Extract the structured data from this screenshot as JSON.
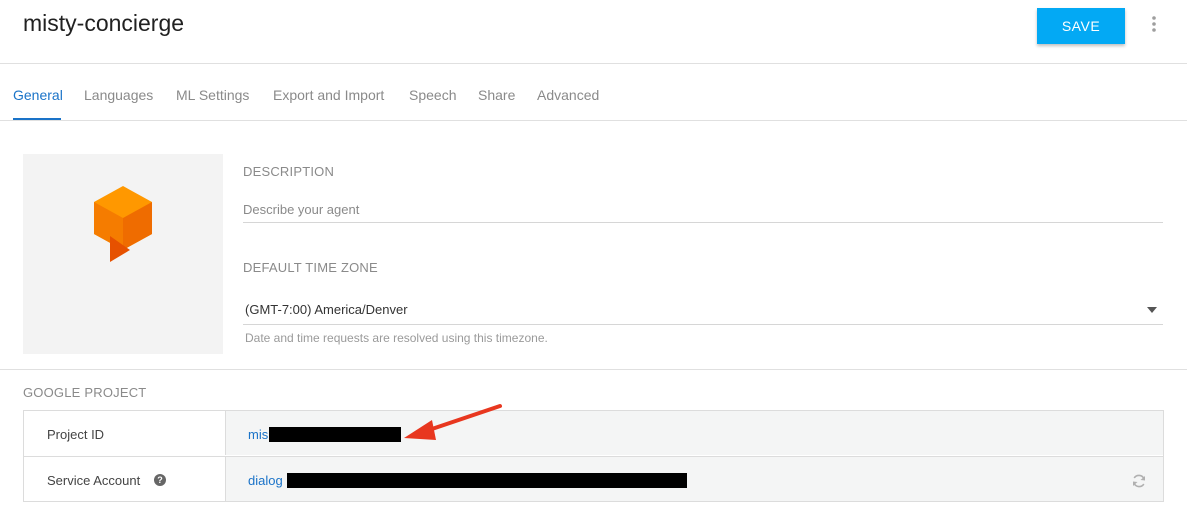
{
  "header": {
    "agent_name": "misty-concierge",
    "save_label": "SAVE",
    "more_icon": "more-vert-icon"
  },
  "tabs": [
    {
      "label": "General",
      "active": true
    },
    {
      "label": "Languages"
    },
    {
      "label": "ML Settings"
    },
    {
      "label": "Export and Import"
    },
    {
      "label": "Speech"
    },
    {
      "label": "Share"
    },
    {
      "label": "Advanced"
    }
  ],
  "general": {
    "avatar_icon": "dialogflow-logo-icon",
    "description_label": "DESCRIPTION",
    "description_placeholder": "Describe your agent",
    "timezone_label": "DEFAULT TIME ZONE",
    "timezone_value": "(GMT-7:00) America/Denver",
    "timezone_hint": "Date and time requests are resolved using this timezone."
  },
  "google_project": {
    "label": "GOOGLE PROJECT",
    "rows": [
      {
        "key": "Project ID",
        "value_visible": "mis"
      },
      {
        "key": "Service Account",
        "value_visible": "dialog"
      }
    ]
  },
  "colors": {
    "accent": "#03a9f4",
    "link": "#1a73c8",
    "annotation_arrow": "#e8371f"
  }
}
